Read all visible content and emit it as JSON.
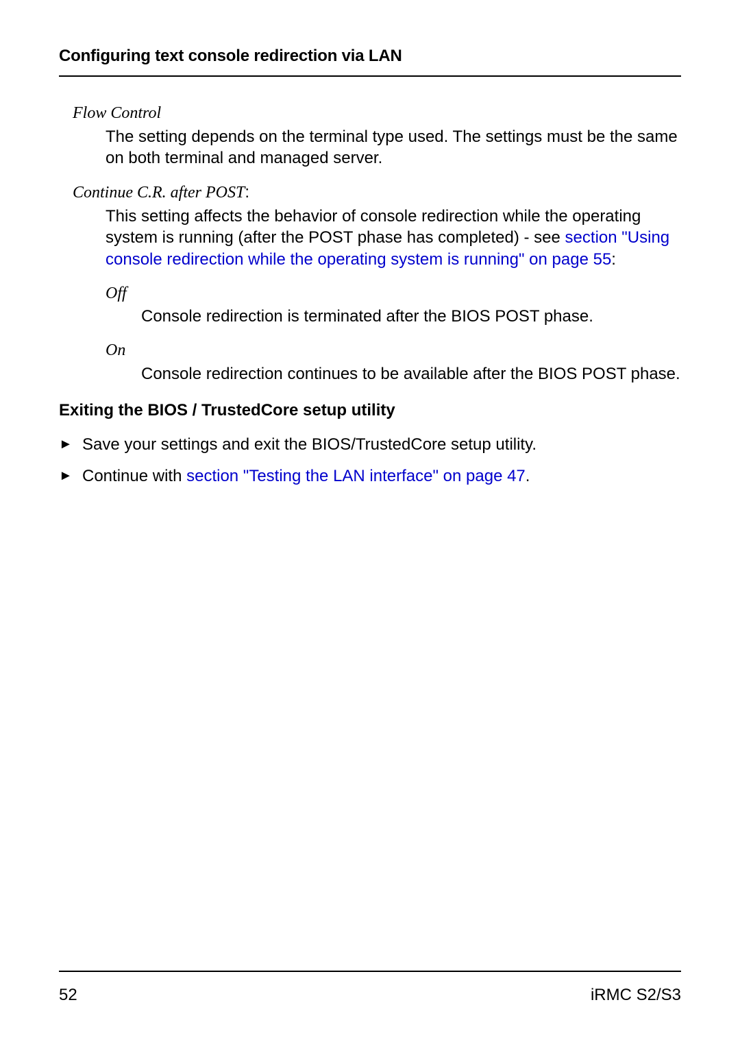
{
  "header": {
    "title": "Configuring text console redirection via LAN"
  },
  "terms": {
    "flowControl": {
      "label": "Flow Control",
      "desc": "The setting depends on the terminal type used. The settings must be the same on both terminal and managed server."
    },
    "continueCR": {
      "label": "Continue C.R. after POST",
      "colon": ":",
      "desc_pre": "This setting affects the behavior of console redirection while the operating system is running (after the POST phase has completed) - see ",
      "link": "section \"Using console redirection while the operating system is running\" on page 55",
      "desc_post": ":",
      "options": {
        "off": {
          "label": "Off",
          "desc": "Console redirection is terminated after the BIOS POST phase."
        },
        "on": {
          "label": "On",
          "desc": "Console redirection continues to be available after the BIOS POST phase."
        }
      }
    }
  },
  "section": {
    "heading": "Exiting the BIOS / TrustedCore setup utility",
    "bullets": {
      "b1": {
        "text": "Save your settings and exit the BIOS/TrustedCore setup utility."
      },
      "b2": {
        "pre": "Continue with ",
        "link": "section \"Testing the LAN interface\" on page 47",
        "post": "."
      }
    }
  },
  "footer": {
    "page": "52",
    "docref": "iRMC S2/S3"
  }
}
